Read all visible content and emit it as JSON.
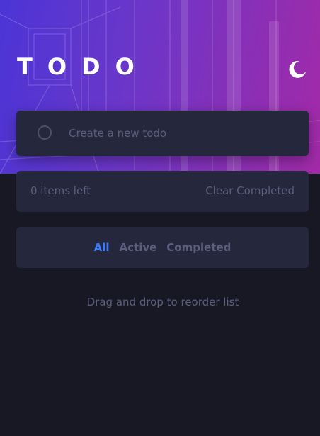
{
  "header": {
    "title": "TODO",
    "theme_toggle_icon": "moon-icon"
  },
  "new_todo": {
    "placeholder": "Create a new todo",
    "value": "",
    "checkbox_icon": "circle-icon"
  },
  "list_footer": {
    "items_left": "0 items left",
    "clear_label": "Clear Completed"
  },
  "filters": {
    "all": "All",
    "active": "Active",
    "completed": "Completed",
    "selected": "All"
  },
  "hint": "Drag and drop to reorder list",
  "colors": {
    "accent": "#3a7cfd",
    "card": "#25273c",
    "background": "#181824",
    "muted_text": "#5b5e7e",
    "gradient_start": "#4b35d6",
    "gradient_end": "#a32aa8"
  }
}
